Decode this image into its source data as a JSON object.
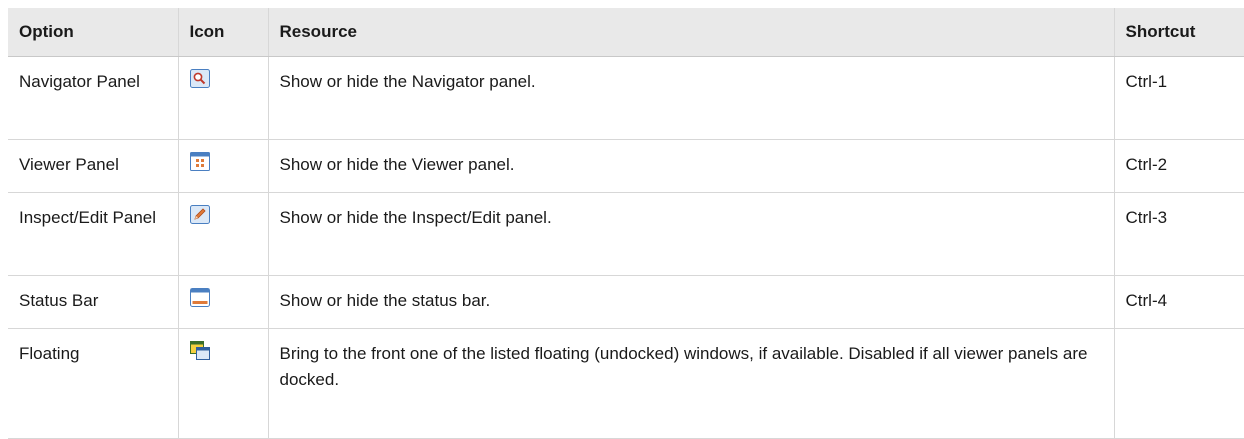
{
  "table": {
    "headers": {
      "option": "Option",
      "icon": "Icon",
      "resource": "Resource",
      "shortcut": "Shortcut"
    },
    "rows": [
      {
        "option": "Navigator Panel",
        "icon": "navigator-panel-icon",
        "resource": "Show or hide the Navigator panel.",
        "shortcut": "Ctrl-1"
      },
      {
        "option": "Viewer Panel",
        "icon": "viewer-panel-icon",
        "resource": "Show or hide the Viewer panel.",
        "shortcut": "Ctrl-2"
      },
      {
        "option": "Inspect/Edit Panel",
        "icon": "inspect-edit-panel-icon",
        "resource": "Show or hide the Inspect/Edit panel.",
        "shortcut": "Ctrl-3"
      },
      {
        "option": "Status Bar",
        "icon": "status-bar-icon",
        "resource": "Show or hide the status bar.",
        "shortcut": "Ctrl-4"
      },
      {
        "option": "Floating",
        "icon": "floating-windows-icon",
        "resource": "Bring to the front one of the listed floating (undocked) windows, if available. Disabled if all viewer panels are docked.",
        "shortcut": ""
      }
    ]
  },
  "colors": {
    "header_bg": "#e9e9e9",
    "icon_frame": "#4a7fc1",
    "icon_accent": "#e07b39"
  }
}
